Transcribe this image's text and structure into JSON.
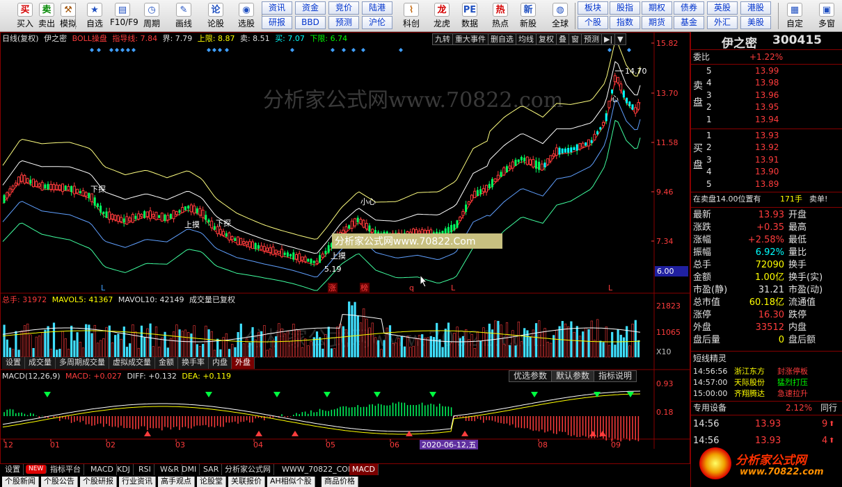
{
  "toolbar": {
    "buttons": [
      {
        "label": "买入",
        "icon": "buy-icon",
        "glyph": "买",
        "color": "#d40000"
      },
      {
        "label": "卖出",
        "icon": "sell-icon",
        "glyph": "卖",
        "color": "#008800"
      },
      {
        "label": "模拟",
        "icon": "hammer-icon",
        "glyph": "⚒",
        "color": "#a05000"
      },
      {
        "label": "自选",
        "icon": "favorite-icon",
        "glyph": "★",
        "color": "#2050c0"
      },
      {
        "label": "F10/F9",
        "icon": "f10-icon",
        "glyph": "▤",
        "color": "#2050c0"
      },
      {
        "label": "周期",
        "icon": "clock-icon",
        "glyph": "◷",
        "color": "#2050c0"
      },
      {
        "label": "画线",
        "icon": "pencil-icon",
        "glyph": "✎",
        "color": "#2050c0"
      },
      {
        "label": "论股",
        "icon": "discuss-icon",
        "glyph": "论",
        "color": "#2050c0"
      },
      {
        "label": "选股",
        "icon": "select-icon",
        "glyph": "◉",
        "color": "#2050c0"
      }
    ],
    "square_buttons": [
      [
        "资讯",
        "资金",
        "竞价",
        "陆港"
      ],
      [
        "研报",
        "BBD",
        "预测",
        "沪伦"
      ]
    ],
    "buttons2": [
      {
        "label": "科创",
        "icon": "chart-icon",
        "glyph": "⌇",
        "color": "#c06000"
      },
      {
        "label": "龙虎",
        "icon": "dragon-icon",
        "glyph": "龙",
        "color": "#d40000"
      },
      {
        "label": "数据",
        "icon": "pe-icon",
        "glyph": "PE",
        "color": "#2050c0"
      },
      {
        "label": "热点",
        "icon": "hot-icon",
        "glyph": "热",
        "color": "#d40000"
      },
      {
        "label": "新股",
        "icon": "newstock-icon",
        "glyph": "新",
        "color": "#2050c0"
      },
      {
        "label": "全球",
        "icon": "globe-icon",
        "glyph": "◍",
        "color": "#2050c0"
      }
    ],
    "square_buttons2": [
      [
        "板块",
        "股指",
        "期权",
        "债券",
        "英股",
        "港股"
      ],
      [
        "个股",
        "指数",
        "期货",
        "基金",
        "外汇",
        "美股"
      ]
    ],
    "buttons3": [
      {
        "label": "自定",
        "icon": "custom-icon",
        "glyph": "▦",
        "color": "#2050c0"
      },
      {
        "label": "多窗",
        "icon": "multiwindow-icon",
        "glyph": "▣",
        "color": "#2050c0"
      }
    ]
  },
  "kline": {
    "header": {
      "period": "日线(复权)",
      "stock": "伊之密",
      "indicator": "BOLL操盘",
      "guide": "指导线: 7.84",
      "boundary": "界: 7.79",
      "upper": "上限: 8.87",
      "sell": "卖: 8.51",
      "buy": "买: 7.07",
      "lower": "下限: 6.74"
    },
    "buttons": [
      "九转",
      "重大事件",
      "删自选",
      "均线",
      "复权",
      "叠",
      "窗",
      "预测",
      "▶|",
      "▼"
    ],
    "yaxis": [
      "15.82",
      "13.70",
      "11.58",
      "9.46",
      "7.34",
      "6.00"
    ],
    "watermark": "分析家公式网www.70822.com",
    "banner": "分析家公式网www.70822.Com",
    "high_label": "14.70",
    "low_label": "5.19",
    "annotations": [
      "下探",
      "上摸",
      "下探",
      "上摸",
      "小心",
      "心"
    ],
    "markers": [
      "L",
      "涨",
      "榜",
      "q",
      "L",
      "L"
    ]
  },
  "volume": {
    "header": {
      "total": "总手: 31972",
      "mavol5": "MAVOL5: 41367",
      "mavol10": "MAVOL10: 42149",
      "note": "成交量已复权"
    },
    "yaxis": [
      "21823",
      "11065",
      "X10"
    ],
    "tabs": [
      "设置",
      "成交量",
      "多周期成交量",
      "虚拟成交量",
      "金额",
      "换手率",
      "内盘",
      "外盘"
    ],
    "active_tab": "外盘"
  },
  "macd": {
    "header": {
      "name": "MACD(12,26,9)",
      "macd": "MACD: +0.027",
      "diff": "DIFF: +0.132",
      "dea": "DEA: +0.119"
    },
    "buttons": [
      "优选参数",
      "默认参数",
      "指标说明"
    ],
    "yaxis": [
      "0.93",
      "0.18"
    ]
  },
  "xaxis": {
    "months": [
      "12",
      "01",
      "02",
      "03",
      "04",
      "05",
      "06",
      "07",
      "08",
      "09"
    ],
    "cursor_date": "2020-06-12,五"
  },
  "bottom_tabs": {
    "items": [
      "设置",
      "NEW",
      "指标平台",
      "MACD",
      "KDJ",
      "RSI",
      "W&R",
      "DMI",
      "SAR",
      "分析家公式网",
      "WWW_70822_COM",
      "MACD"
    ],
    "active": "MACD"
  },
  "news_tabs": [
    "个股新闻",
    "个股公告",
    "个股研报",
    "行业资讯",
    "高手观点",
    "论股堂",
    "关联报价",
    "AH相似个股",
    "商品价格"
  ],
  "quote": {
    "name": "伊之密",
    "code": "300415",
    "weibi_label": "委比",
    "weibi_value": "+1.22%",
    "sell_label": "卖盘",
    "buy_label": "买盘",
    "asks": [
      {
        "level": "5",
        "price": "13.99"
      },
      {
        "level": "4",
        "price": "13.98"
      },
      {
        "level": "3",
        "price": "13.96"
      },
      {
        "level": "2",
        "price": "13.95"
      },
      {
        "level": "1",
        "price": "13.94"
      }
    ],
    "bids": [
      {
        "level": "1",
        "price": "13.93"
      },
      {
        "level": "2",
        "price": "13.92"
      },
      {
        "level": "3",
        "price": "13.91"
      },
      {
        "level": "4",
        "price": "13.90"
      },
      {
        "level": "5",
        "price": "13.89"
      }
    ],
    "pending_text": "在卖盘14.00位置有",
    "pending_qty": "171手",
    "pending_tag": "卖单!",
    "stats": [
      {
        "l": "最新",
        "v": "13.93",
        "c": "red",
        "l2": "开盘",
        "v2": ""
      },
      {
        "l": "涨跌",
        "v": "+0.35",
        "c": "red",
        "l2": "最高",
        "v2": ""
      },
      {
        "l": "涨幅",
        "v": "+2.58%",
        "c": "red",
        "l2": "最低",
        "v2": ""
      },
      {
        "l": "振幅",
        "v": "6.92%",
        "c": "cyan",
        "l2": "量比",
        "v2": ""
      },
      {
        "l": "总手",
        "v": "72090",
        "c": "yel",
        "l2": "换手",
        "v2": ""
      },
      {
        "l": "金额",
        "v": "1.00亿",
        "c": "yel",
        "l2": "换手(实)",
        "v2": ""
      },
      {
        "l": "市盈(静)",
        "v": "31.21",
        "c": "wht",
        "l2": "市盈(动)",
        "v2": ""
      },
      {
        "l": "总市值",
        "v": "60.18亿",
        "c": "yel",
        "l2": "流通值",
        "v2": ""
      },
      {
        "l": "涨停",
        "v": "16.30",
        "c": "red",
        "l2": "跌停",
        "v2": ""
      },
      {
        "l": "外盘",
        "v": "33512",
        "c": "red",
        "l2": "内盘",
        "v2": ""
      },
      {
        "l": "盘后量",
        "v": "0",
        "c": "yel",
        "l2": "盘后额",
        "v2": ""
      }
    ],
    "sprite_title": "短线精灵",
    "sprite": [
      {
        "t": "14:56:56",
        "s": "浙江东方",
        "e": "封涨停板"
      },
      {
        "t": "14:57:00",
        "s": "天际股份",
        "e": "猛烈打压"
      },
      {
        "t": "15:00:00",
        "s": "齐翔腾达",
        "e": "急速拉升"
      }
    ],
    "device_label": "专用设备",
    "device_value": "2.12%",
    "device_extra": "同行",
    "ticks": [
      {
        "t": "14:56",
        "p": "13.93",
        "v": "9"
      },
      {
        "t": "14:56",
        "p": "13.93",
        "v": "4"
      }
    ],
    "logo_text": "分析家公式网",
    "logo_url": "www.70822.com"
  }
}
